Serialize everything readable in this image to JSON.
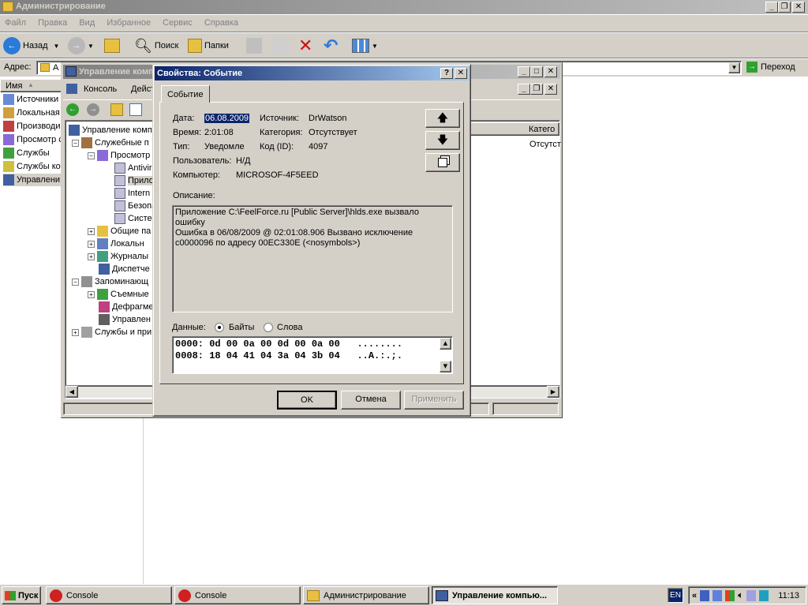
{
  "main_window": {
    "title": "Администрирование",
    "menu": [
      "Файл",
      "Правка",
      "Вид",
      "Избранное",
      "Сервис",
      "Справка"
    ],
    "toolbar": {
      "back": "Назад",
      "search": "Поиск",
      "folders": "Папки"
    },
    "address_label": "Адрес:",
    "address_value": "А",
    "go": "Переход",
    "column_name": "Имя",
    "left_items": [
      "Источники",
      "Локальная",
      "Производи",
      "Просмотр с",
      "Службы",
      "Службы ко",
      "Управлени"
    ]
  },
  "mmc": {
    "title": "Управление компьютером",
    "menu": {
      "console": "Консоль",
      "action": "Действие"
    },
    "tree": [
      "Управление комп",
      "Служебные п",
      "Просмотр",
      "Antivir",
      "Прило",
      "Intern",
      "Безопа",
      "Систе",
      "Общие па",
      "Локальн",
      "Журналы",
      "Диспетче",
      "Запоминающ",
      "Съемные",
      "Дефрагме",
      "Управлен",
      "Службы и при"
    ],
    "right_header": "Катего",
    "right_value": "Отсутст"
  },
  "dialog": {
    "title": "Свойства: Событие",
    "tab": "Событие",
    "date_label": "Дата:",
    "date_value": "06.08.2009",
    "time_label": "Время:",
    "time_value": "2:01:08",
    "type_label": "Тип:",
    "type_value": "Уведомле",
    "user_label": "Пользователь:",
    "user_value": "Н/Д",
    "computer_label": "Компьютер:",
    "computer_value": "MICROSOF-4F5EED",
    "source_label": "Источник:",
    "source_value": "DrWatson",
    "category_label": "Категория:",
    "category_value": "Отсутствует",
    "code_label": "Код (ID):",
    "code_value": "4097",
    "description_label": "Описание:",
    "description_lines": [
      "Приложение C:\\FeelForce.ru [Public Server]\\hlds.exe вызвало ошибку",
      "Ошибка в 06/08/2009 @ 02:01:08.906 Вызвано исключение",
      "c0000096 по адресу 00EC330E (<nosymbols>)"
    ],
    "data_label": "Данные:",
    "radio_bytes": "Байты",
    "radio_words": "Слова",
    "data_lines": [
      "0000: 0d 00 0a 00 0d 00 0a 00   ........",
      "0008: 18 04 41 04 3a 04 3b 04   ..A.:.;."
    ],
    "ok": "OK",
    "cancel": "Отмена",
    "apply": "Применить"
  },
  "taskbar": {
    "start": "Пуск",
    "tasks": [
      "Console",
      "Console",
      "Администрирование",
      "Управление компью..."
    ],
    "lang": "EN",
    "clock": "11:13"
  }
}
